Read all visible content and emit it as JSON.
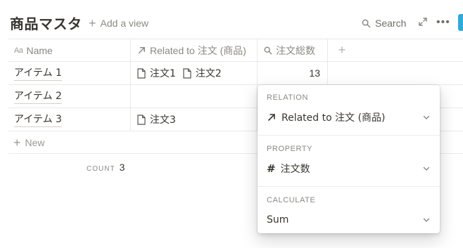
{
  "header": {
    "title": "商品マスタ",
    "add_view_label": "Add a view",
    "search_label": "Search"
  },
  "table": {
    "columns": [
      {
        "label": "Name",
        "icon": "text-aa-icon"
      },
      {
        "label": "Related to 注文 (商品)",
        "icon": "arrow-up-right-icon"
      },
      {
        "label": "注文総数",
        "icon": "search-icon"
      }
    ],
    "rows": [
      {
        "name": "アイテム 1",
        "related": [
          "注文1",
          "注文2"
        ],
        "total": "13"
      },
      {
        "name": "アイテム 2",
        "related": [],
        "total": ""
      },
      {
        "name": "アイテム 3",
        "related": [
          "注文3"
        ],
        "total": ""
      }
    ],
    "new_label": "New",
    "count_label": "COUNT",
    "count_value": "3"
  },
  "popover": {
    "relation_label": "RELATION",
    "relation_value": "Related to 注文 (商品)",
    "property_label": "PROPERTY",
    "property_value": "注文数",
    "calculate_label": "CALCULATE",
    "calculate_value": "Sum"
  },
  "colors": {
    "text": "#37352f",
    "muted": "#8a8984",
    "border": "#e9e9e7",
    "accent": "#2eaadc"
  }
}
